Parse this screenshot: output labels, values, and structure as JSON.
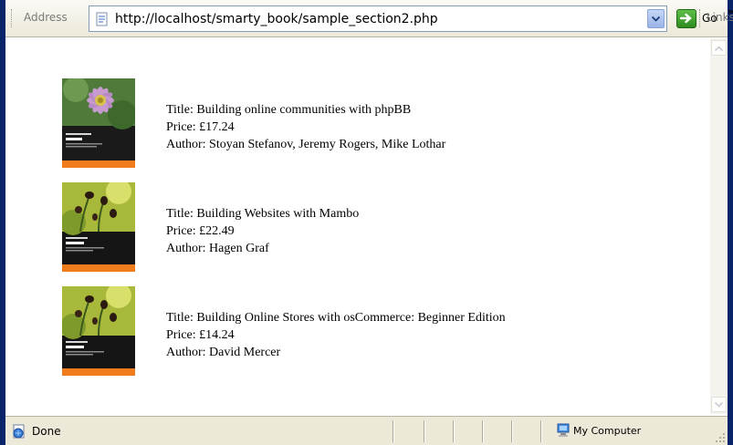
{
  "addressbar": {
    "label": "Address",
    "url": "http://localhost/smarty_book/sample_section2.php",
    "go_label": "Go",
    "links_label": "Links",
    "links_more": "»"
  },
  "books": [
    {
      "title": "Title: Building online communities with phpBB",
      "price": "Price: £17.24",
      "author": "Author: Stoyan Stefanov, Jeremy Rogers, Mike Lothar",
      "cover_icon": "book-cover-flower"
    },
    {
      "title": "Title: Building Websites with Mambo",
      "price": "Price: £22.49",
      "author": "Author: Hagen Graf",
      "cover_icon": "book-cover-poppies"
    },
    {
      "title": "Title: Building Online Stores with osCommerce: Beginner Edition",
      "price": "Price: £14.24",
      "author": "Author: David Mercer",
      "cover_icon": "book-cover-poppies"
    }
  ],
  "statusbar": {
    "status": "Done",
    "zone": "My Computer"
  },
  "colors": {
    "window_border": "#0a246a",
    "chrome_bg": "#ece9d8",
    "go_green": "#2e8b1f",
    "cover_orange": "#f07c1c"
  }
}
